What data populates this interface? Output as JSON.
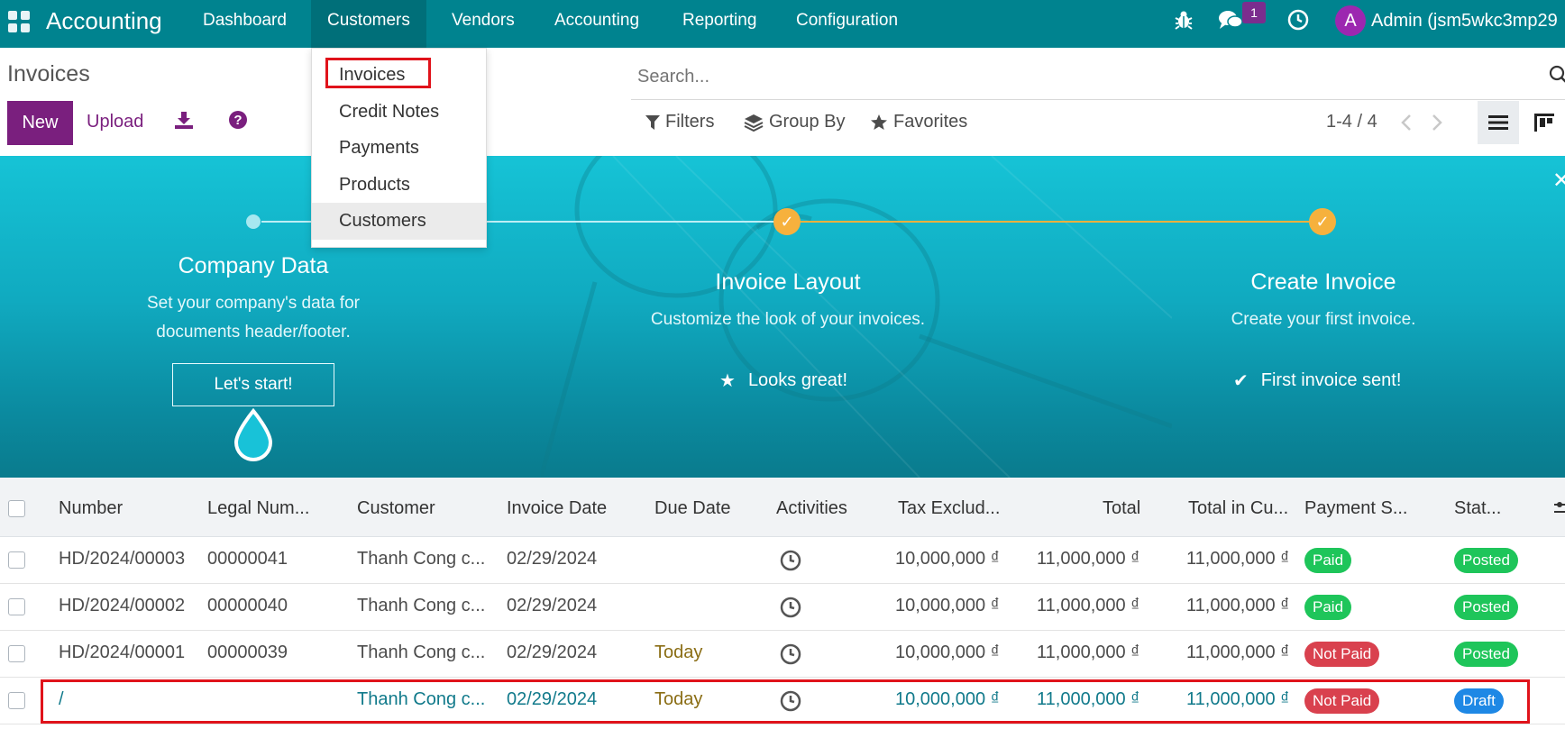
{
  "navbar": {
    "brand": "Accounting",
    "menus": [
      "Dashboard",
      "Customers",
      "Vendors",
      "Accounting",
      "Reporting",
      "Configuration"
    ],
    "chat_count": "1",
    "avatar_letter": "A",
    "user": "Admin (jsm5wkc3mp29"
  },
  "control_panel": {
    "title": "Invoices",
    "new_label": "New",
    "upload_label": "Upload",
    "search_placeholder": "Search...",
    "filters_label": "Filters",
    "groupby_label": "Group By",
    "favorites_label": "Favorites",
    "pager": "1-4 / 4"
  },
  "dropdown": {
    "items": [
      "Invoices",
      "Credit Notes",
      "Payments",
      "Products",
      "Customers"
    ]
  },
  "onboarding": {
    "steps": [
      {
        "title": "Company Data",
        "desc1": "Set your company's data for",
        "desc2": "documents header/footer.",
        "button": "Let's start!"
      },
      {
        "title": "Invoice Layout",
        "desc1": "Customize the look of your invoices.",
        "done": "Looks great!"
      },
      {
        "title": "Create Invoice",
        "desc1": "Create your first invoice.",
        "done": "First invoice sent!"
      }
    ]
  },
  "table": {
    "headers": [
      "Number",
      "Legal Num...",
      "Customer",
      "Invoice Date",
      "Due Date",
      "Activities",
      "Tax Exclud...",
      "Total",
      "Total in Cu...",
      "Payment S...",
      "Stat..."
    ],
    "rows": [
      {
        "number": "HD/2024/00003",
        "legal": "00000041",
        "customer": "Thanh Cong c...",
        "date": "02/29/2024",
        "due": "",
        "tax_excl": "10,000,000 ₫",
        "total": "11,000,000 ₫",
        "total_cur": "11,000,000 ₫",
        "payment": "Paid",
        "status": "Posted"
      },
      {
        "number": "HD/2024/00002",
        "legal": "00000040",
        "customer": "Thanh Cong c...",
        "date": "02/29/2024",
        "due": "",
        "tax_excl": "10,000,000 ₫",
        "total": "11,000,000 ₫",
        "total_cur": "11,000,000 ₫",
        "payment": "Paid",
        "status": "Posted"
      },
      {
        "number": "HD/2024/00001",
        "legal": "00000039",
        "customer": "Thanh Cong c...",
        "date": "02/29/2024",
        "due": "Today",
        "tax_excl": "10,000,000 ₫",
        "total": "11,000,000 ₫",
        "total_cur": "11,000,000 ₫",
        "payment": "Not Paid",
        "status": "Posted"
      },
      {
        "number": "/",
        "legal": "",
        "customer": "Thanh Cong c...",
        "date": "02/29/2024",
        "due": "Today",
        "tax_excl": "10,000,000 ₫",
        "total": "11,000,000 ₫",
        "total_cur": "11,000,000 ₫",
        "payment": "Not Paid",
        "status": "Draft"
      }
    ]
  },
  "colors": {
    "navbar": "#00838f",
    "primary": "#7a1f7e",
    "paid": "#1ec55a",
    "not_paid": "#d9414e",
    "draft": "#1e88e5",
    "highlight": "#e0131b"
  }
}
